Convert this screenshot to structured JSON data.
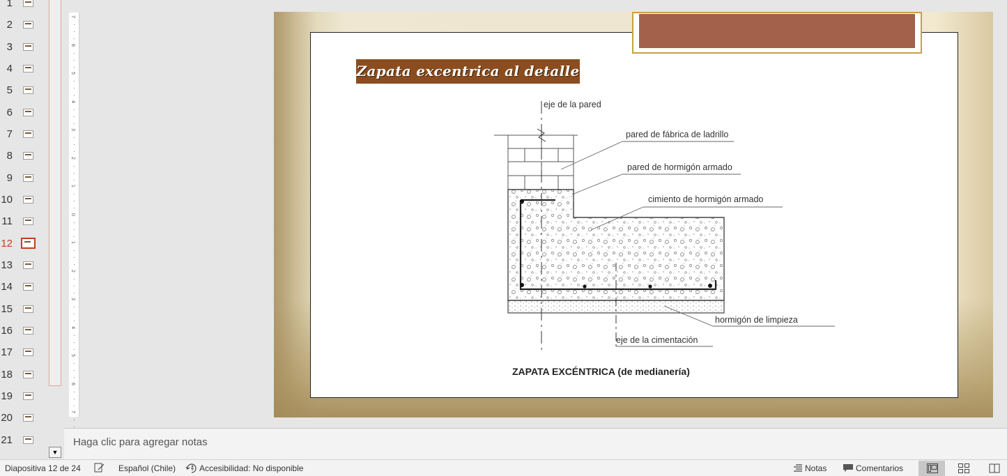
{
  "thumbnails": {
    "items": [
      {
        "num": "1"
      },
      {
        "num": "2"
      },
      {
        "num": "3"
      },
      {
        "num": "4"
      },
      {
        "num": "5"
      },
      {
        "num": "6"
      },
      {
        "num": "7"
      },
      {
        "num": "8"
      },
      {
        "num": "9"
      },
      {
        "num": "10"
      },
      {
        "num": "11"
      },
      {
        "num": "12"
      },
      {
        "num": "13"
      },
      {
        "num": "14"
      },
      {
        "num": "15"
      },
      {
        "num": "16"
      },
      {
        "num": "17"
      },
      {
        "num": "18"
      },
      {
        "num": "19"
      },
      {
        "num": "20"
      },
      {
        "num": "21"
      }
    ],
    "active": "12"
  },
  "ruler": {
    "ticks": [
      "7",
      "6",
      "5",
      "4",
      "3",
      "2",
      "1",
      "0",
      "1",
      "2",
      "3",
      "4",
      "5",
      "6",
      "7"
    ]
  },
  "slide": {
    "heading": "Zapata excentrica al detalle",
    "accent_color": "#a3614c",
    "heading_bg": "#8b4d1f",
    "diagram": {
      "labels": {
        "eje_pared": "eje de la pared",
        "pared_ladrillo": "pared de fábrica de ladrillo",
        "pared_hormigon": "pared de hormigón armado",
        "cimiento": "cimiento de hormigón armado",
        "limpieza": "hormigón de limpieza",
        "eje_cimentacion": "eje de la cimentación"
      },
      "caption": "ZAPATA EXCÉNTRICA (de medianería)"
    }
  },
  "notes": {
    "placeholder": "Haga clic para agregar notas"
  },
  "statusbar": {
    "slide_counter": "Diapositiva 12 de 24",
    "language": "Español (Chile)",
    "accessibility": "Accesibilidad: No disponible",
    "notes_label": "Notas",
    "comments_label": "Comentarios"
  }
}
